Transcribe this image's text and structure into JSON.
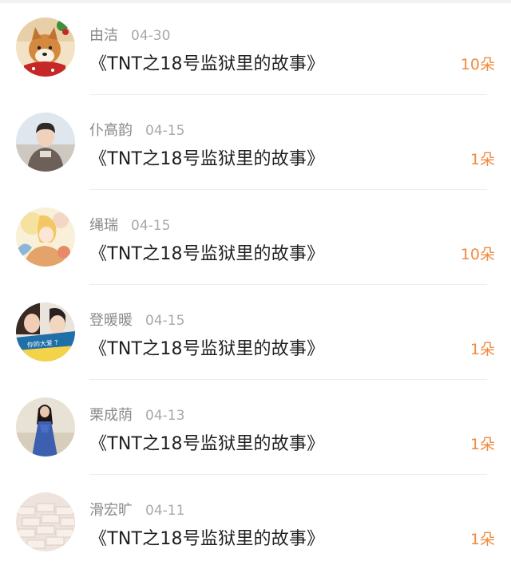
{
  "colors": {
    "name": "#8a8a8a",
    "date": "#a8a8a8",
    "title": "#1f1f1f",
    "count": "#f08a3e",
    "divider": "#eeeeee"
  },
  "items": [
    {
      "name": "由洁",
      "date": "04-30",
      "title": "《TNT之18号监狱里的故事》",
      "count": "10朵",
      "avatar": "shiba-dog-avatar"
    },
    {
      "name": "仆高韵",
      "date": "04-15",
      "title": "《TNT之18号监狱里的故事》",
      "count": "1朵",
      "avatar": "boy-photo-avatar"
    },
    {
      "name": "绳瑞",
      "date": "04-15",
      "title": "《TNT之18号监狱里的故事》",
      "count": "10朵",
      "avatar": "anime-illustration-avatar"
    },
    {
      "name": "登暖暖",
      "date": "04-15",
      "title": "《TNT之18号监狱里的故事》",
      "count": "1朵",
      "avatar": "couple-photo-avatar",
      "avatar_caption": "你的大爱 ?"
    },
    {
      "name": "栗成荫",
      "date": "04-13",
      "title": "《TNT之18号监狱里的故事》",
      "count": "1朵",
      "avatar": "girl-blue-dress-avatar"
    },
    {
      "name": "滑宏旷",
      "date": "04-11",
      "title": "《TNT之18号监狱里的故事》",
      "count": "1朵",
      "avatar": "brick-wall-avatar"
    }
  ]
}
